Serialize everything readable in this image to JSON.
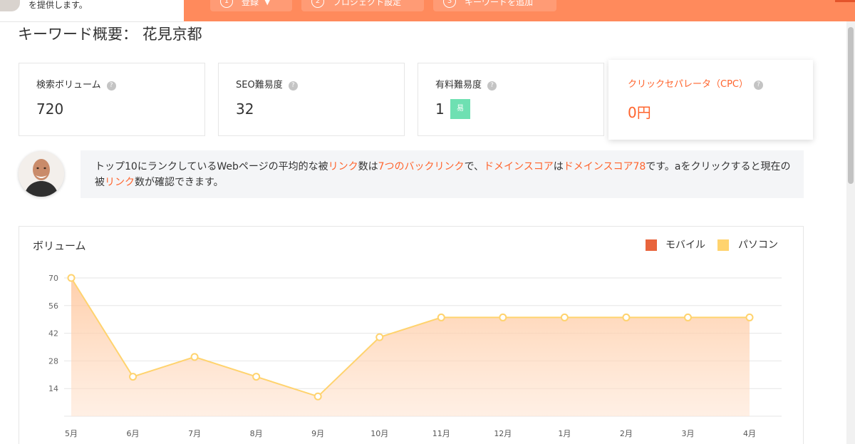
{
  "header": {
    "intro_text": "を提供します。",
    "steps": [
      {
        "num": "1",
        "label": "登録",
        "chevron": "chevron-down-icon"
      },
      {
        "num": "2",
        "label": "プロジェクト設定"
      },
      {
        "num": "3",
        "label": "キーワードを追加"
      }
    ]
  },
  "page": {
    "title": "キーワード概要： 花見京都"
  },
  "metrics": {
    "search_volume": {
      "label": "検索ボリューム",
      "value": "720"
    },
    "seo_difficulty": {
      "label": "SEO難易度",
      "value": "32"
    },
    "paid_difficulty": {
      "label": "有料難易度",
      "value": "1",
      "badge": "易"
    },
    "cpc": {
      "label": "クリックセパレータ（CPC）",
      "value": "0円"
    }
  },
  "tip": {
    "parts": [
      {
        "text": "トップ10にランクしているWebページの平均的な被",
        "hl": false
      },
      {
        "text": "リンク",
        "hl": true
      },
      {
        "text": "数は",
        "hl": false
      },
      {
        "text": "7つのバックリンク",
        "hl": true
      },
      {
        "text": "で、",
        "hl": false
      },
      {
        "text": "ドメインスコア",
        "hl": true
      },
      {
        "text": "は",
        "hl": false
      },
      {
        "text": "ドメインスコア78",
        "hl": true
      },
      {
        "text": "です。aをクリックすると現在の被",
        "hl": false
      },
      {
        "text": "リンク",
        "hl": true
      },
      {
        "text": "数が確認できます。",
        "hl": false
      }
    ]
  },
  "colors": {
    "accent": "#ff642d",
    "topbar": "#ff8a5c",
    "mobile": "#e8643c",
    "desktop": "#ffd36e",
    "easy_badge": "#6ee0b2"
  },
  "chart_data": {
    "type": "area",
    "title": "ボリューム",
    "legend": [
      {
        "name": "モバイル",
        "color": "#e8643c"
      },
      {
        "name": "パソコン",
        "color": "#ffd36e"
      }
    ],
    "legend_position": "top-right",
    "grid": true,
    "categories": [
      "5月",
      "6月",
      "7月",
      "8月",
      "9月",
      "10月",
      "11月",
      "12月",
      "1月",
      "2月",
      "3月",
      "4月"
    ],
    "yticks": [
      14,
      28,
      42,
      56,
      70
    ],
    "ylim": [
      0,
      70
    ],
    "series": [
      {
        "name": "パソコン",
        "values": [
          70,
          20,
          30,
          20,
          10,
          40,
          50,
          50,
          50,
          50,
          50,
          50
        ]
      }
    ]
  }
}
